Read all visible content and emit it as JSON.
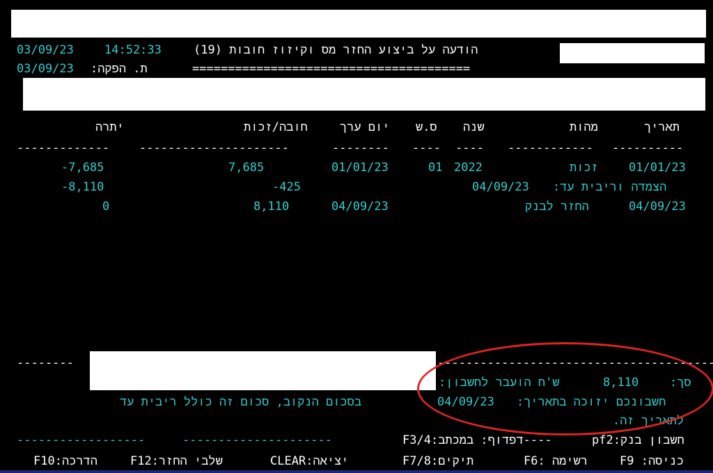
{
  "header": {
    "date": "03/09/23",
    "time": "14:52:33",
    "title": "הודעה על ביצוע החזר מס וקיזוז חובות (19)",
    "print_date_label": "ת. הפקה:",
    "print_date": "03/09/23",
    "underline": "======================================="
  },
  "table": {
    "columns": [
      "תאריך",
      "מהות",
      "שנה",
      "ס.ש",
      "יום ערך",
      "חובה/זכות",
      "יתרה"
    ],
    "dashes": {
      "date": "----------",
      "nature": "------------",
      "year": "----",
      "ss": "----",
      "value_day": "--------",
      "debit_credit": "---------------------",
      "balance": "-------------"
    },
    "rows": [
      {
        "date": "01/01/23",
        "nature": "זכות",
        "year": "2022",
        "ss": "01",
        "value_day": "01/01/23",
        "amount": "7,685",
        "balance": "-7,685"
      },
      {
        "label": "הצמדה וריבית עד:",
        "label_date": "04/09/23",
        "amount": "-425",
        "balance": "-8,110"
      },
      {
        "date": "04/09/23",
        "nature": "החזר לבנק",
        "value_day": "04/09/23",
        "amount": "8,110",
        "balance": "0"
      }
    ]
  },
  "summary": {
    "left_dashes": "--------",
    "right_dashes": "-----------------------------------------",
    "total_label": "סך:",
    "total_value": "8,110",
    "transfer_text": "ש'ח הועבר לחשבון:",
    "line2_right": "חשבונכם יזוכה בתאריך:",
    "line2_date": "04/09/23",
    "line2_left": "בסכום הנקוב, סכום זה כולל ריבית עד",
    "line3": "לתאריך זה.",
    "bank_account": "חשבון בנק:pf2",
    "print_option": "----דפדוף: במכתב:F3/4",
    "footer_dashes_1": "------------------",
    "footer_dashes_2": "---------------------"
  },
  "function_keys": [
    {
      "key": "כניסה: F9",
      "id": "f9"
    },
    {
      "key": "רשימה :F6",
      "id": "f6"
    },
    {
      "key": "תיקים:F7/8",
      "id": "f78"
    },
    {
      "key": "יציאה:CLEAR",
      "id": "clear"
    },
    {
      "key": "שלבי החזר:F12",
      "id": "f12"
    },
    {
      "key": "הדרכה:F10",
      "id": "f10"
    }
  ],
  "colors": {
    "background": "#000000",
    "text": "#33cccc",
    "highlight": "#e02424"
  }
}
